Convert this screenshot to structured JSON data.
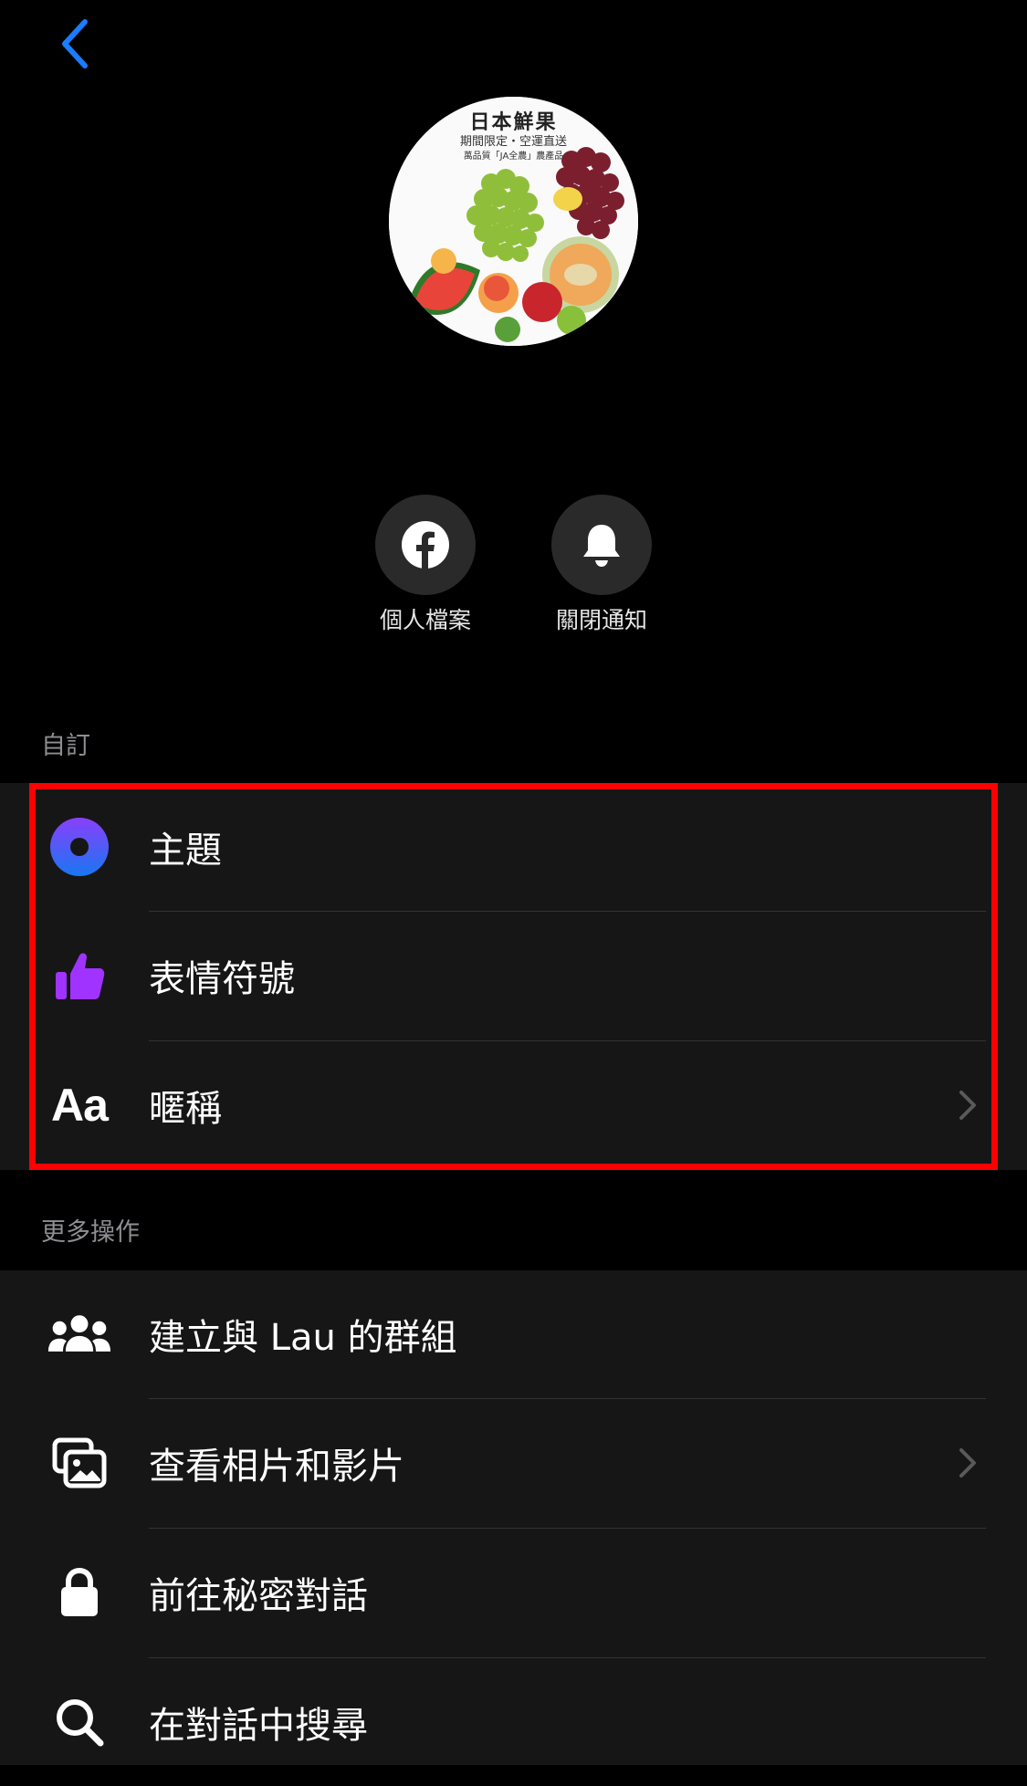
{
  "header": {
    "back_icon": "chevron-left-icon",
    "back_color": "#1a7cff"
  },
  "avatar": {
    "title": "日本鮮果",
    "subtitle": "期間限定・空運直送",
    "tagline": "萬品質「JA全農」農產品"
  },
  "actions": [
    {
      "label": "個人檔案",
      "icon": "facebook-icon"
    },
    {
      "label": "關閉通知",
      "icon": "bell-icon"
    }
  ],
  "customize": {
    "section_label": "自訂",
    "items": [
      {
        "label": "主題",
        "icon": "theme-circle-icon",
        "chevron": false
      },
      {
        "label": "表情符號",
        "icon": "thumbs-up-icon",
        "chevron": false
      },
      {
        "label": "暱稱",
        "icon": "text-aa-icon",
        "chevron": true
      }
    ]
  },
  "more": {
    "section_label": "更多操作",
    "items": [
      {
        "label": "建立與 Lau 的群組",
        "icon": "group-icon",
        "chevron": false
      },
      {
        "label": "查看相片和影片",
        "icon": "photos-icon",
        "chevron": true
      },
      {
        "label": "前往秘密對話",
        "icon": "lock-icon",
        "chevron": false
      },
      {
        "label": "在對話中搜尋",
        "icon": "search-icon",
        "chevron": false
      }
    ]
  },
  "colors": {
    "highlight": "#ff0000",
    "theme_purple": "#8a3ffc",
    "theme_blue": "#1877f2",
    "thumb_purple": "#a033ff"
  }
}
